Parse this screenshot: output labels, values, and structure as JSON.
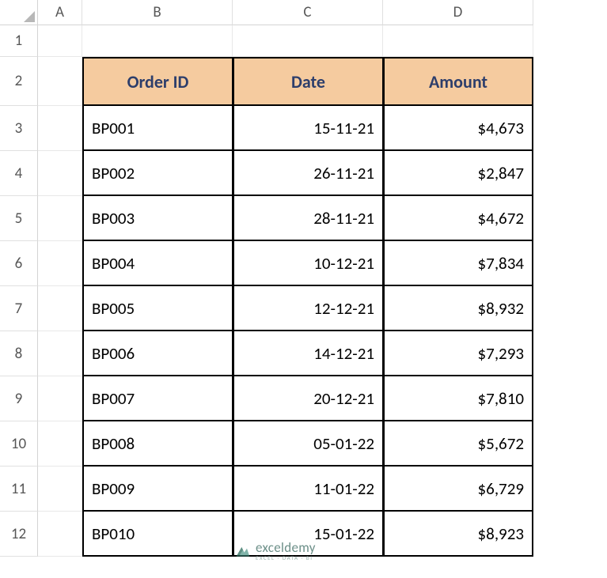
{
  "columns": [
    "A",
    "B",
    "C",
    "D"
  ],
  "row_numbers": [
    "1",
    "2",
    "3",
    "4",
    "5",
    "6",
    "7",
    "8",
    "9",
    "10",
    "11",
    "12"
  ],
  "table": {
    "headers": {
      "order_id": "Order ID",
      "date": "Date",
      "amount": "Amount"
    },
    "rows": [
      {
        "order_id": "BP001",
        "date": "15-11-21",
        "amount": "$4,673"
      },
      {
        "order_id": "BP002",
        "date": "26-11-21",
        "amount": "$2,847"
      },
      {
        "order_id": "BP003",
        "date": "28-11-21",
        "amount": "$4,672"
      },
      {
        "order_id": "BP004",
        "date": "10-12-21",
        "amount": "$7,834"
      },
      {
        "order_id": "BP005",
        "date": "12-12-21",
        "amount": "$8,932"
      },
      {
        "order_id": "BP006",
        "date": "14-12-21",
        "amount": "$7,293"
      },
      {
        "order_id": "BP007",
        "date": "20-12-21",
        "amount": "$7,810"
      },
      {
        "order_id": "BP008",
        "date": "05-01-22",
        "amount": "$5,672"
      },
      {
        "order_id": "BP009",
        "date": "11-01-22",
        "amount": "$6,729"
      },
      {
        "order_id": "BP010",
        "date": "15-01-22",
        "amount": "$8,923"
      }
    ]
  },
  "watermark": {
    "name": "exceldemy",
    "tagline": "EXCEL · DATA · BI"
  }
}
